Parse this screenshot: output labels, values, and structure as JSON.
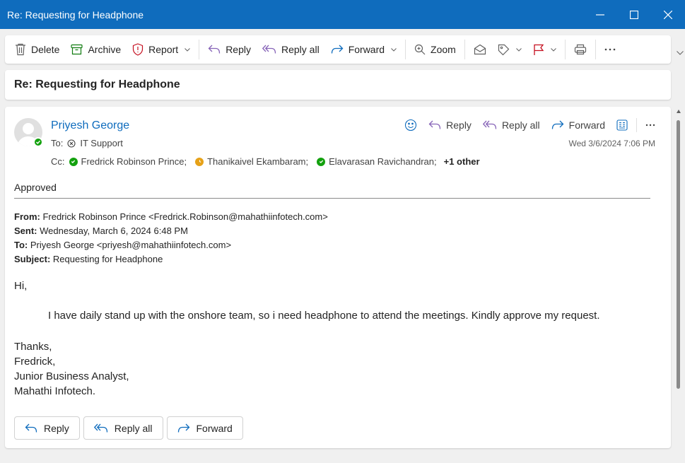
{
  "window": {
    "title": "Re: Requesting for Headphone"
  },
  "toolbar": {
    "delete": "Delete",
    "archive": "Archive",
    "report": "Report",
    "reply": "Reply",
    "reply_all": "Reply all",
    "forward": "Forward",
    "zoom": "Zoom"
  },
  "subject": "Re: Requesting for Headphone",
  "message": {
    "sender": "Priyesh George",
    "to_label": "To:",
    "to": "IT Support",
    "cc_label": "Cc:",
    "cc": [
      {
        "name": "Fredrick Robinson Prince;",
        "status": "available"
      },
      {
        "name": "Thanikaivel Ekambaram;",
        "status": "away"
      },
      {
        "name": "Elavarasan Ravichandran;",
        "status": "available"
      }
    ],
    "cc_more": "+1 other",
    "date": "Wed 3/6/2024 7:06 PM",
    "actions": {
      "reply": "Reply",
      "reply_all": "Reply all",
      "forward": "Forward"
    },
    "body_top": "Approved",
    "quoted": {
      "from_label": "From:",
      "from": " Fredrick Robinson Prince <Fredrick.Robinson@mahathiinfotech.com>",
      "sent_label": "Sent:",
      "sent": " Wednesday, March 6, 2024 6:48 PM",
      "to_label": "To:",
      "to": " Priyesh George <priyesh@mahathiinfotech.com>",
      "subject_label": "Subject:",
      "subject": " Requesting for Headphone"
    },
    "greeting": "Hi,",
    "paragraph": "I have daily stand up with the onshore team, so i need headphone to attend the meetings. Kindly approve my request.",
    "signature": [
      "Thanks,",
      "Fredrick,",
      "Junior Business Analyst,",
      "Mahathi Infotech."
    ]
  },
  "bottom_actions": {
    "reply": "Reply",
    "reply_all": "Reply all",
    "forward": "Forward"
  },
  "colors": {
    "accent": "#0f6cbd",
    "available": "#13a10e",
    "away": "#e6a118"
  },
  "icons": [
    "delete-icon",
    "archive-icon",
    "report-icon",
    "reply-icon",
    "reply-all-icon",
    "forward-icon",
    "zoom-icon",
    "mark-unread-icon",
    "tag-icon",
    "flag-icon",
    "print-icon",
    "more-icon",
    "emoji-icon",
    "immersive-reader-icon"
  ]
}
